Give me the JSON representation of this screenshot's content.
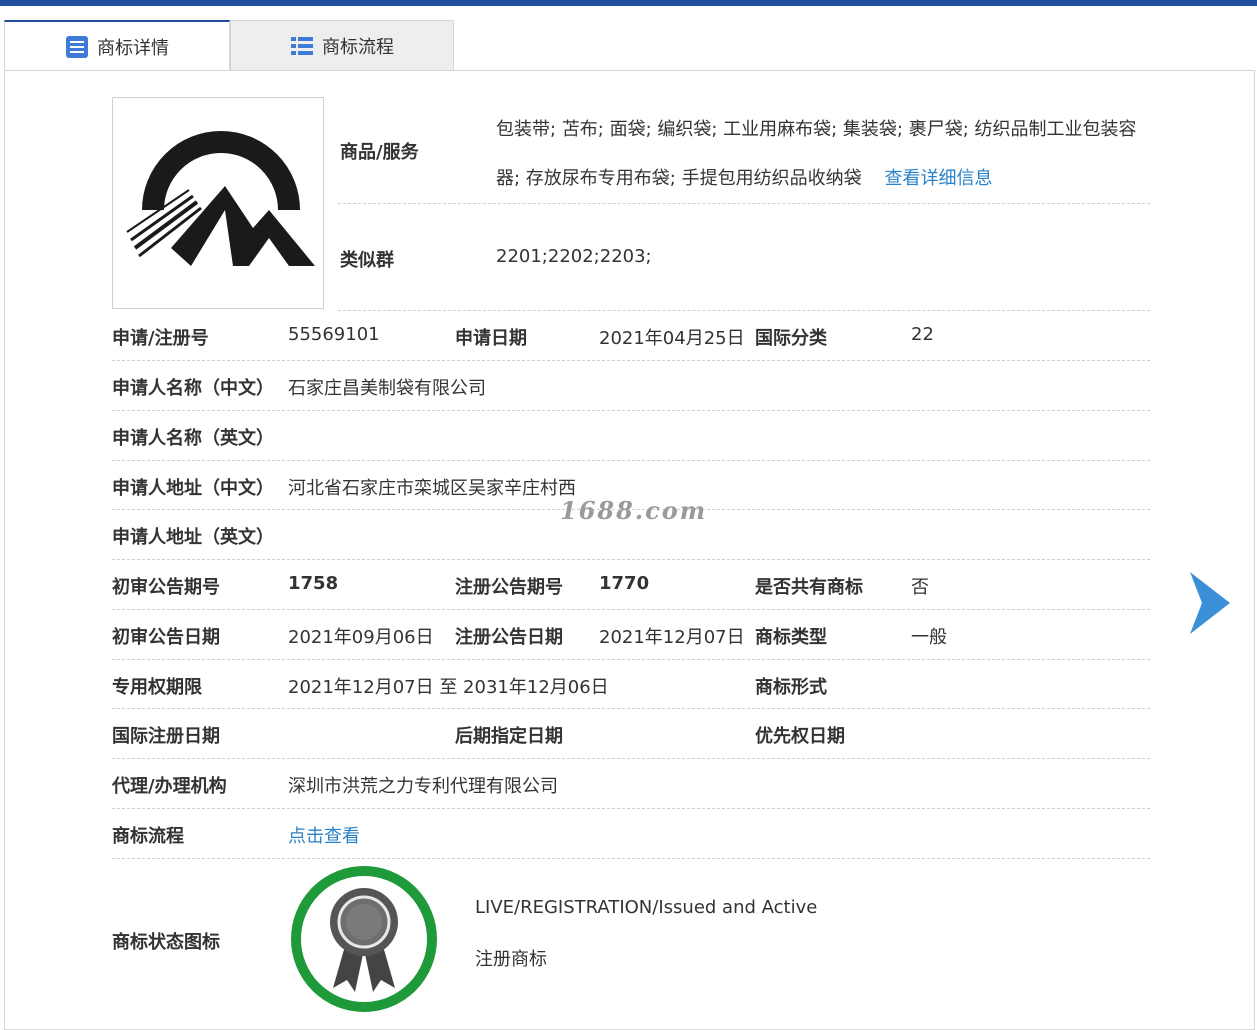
{
  "tabs": {
    "details_label": "商标详情",
    "flow_label": "商标流程"
  },
  "goods": {
    "label": "商品/服务",
    "text": "包装带; 苫布; 面袋; 编织袋; 工业用麻布袋; 集装袋; 裹尸袋; 纺织品制工业包装容器; 存放尿布专用布袋; 手提包用纺织品收纳袋",
    "detail_link": "查看详细信息"
  },
  "similar_group": {
    "label": "类似群",
    "value": "2201;2202;2203;"
  },
  "rows": {
    "reg_no_label": "申请/注册号",
    "reg_no": "55569101",
    "apply_date_label": "申请日期",
    "apply_date": "2021年04月25日",
    "intl_class_label": "国际分类",
    "intl_class": "22",
    "applicant_cn_label": "申请人名称（中文）",
    "applicant_cn": "石家庄昌美制袋有限公司",
    "applicant_en_label": "申请人名称（英文）",
    "address_cn_label": "申请人地址（中文）",
    "address_cn": "河北省石家庄市栾城区吴家辛庄村西",
    "address_en_label": "申请人地址（英文）",
    "prelim_no_label": "初审公告期号",
    "prelim_no": "1758",
    "reg_pub_no_label": "注册公告期号",
    "reg_pub_no": "1770",
    "shared_label": "是否共有商标",
    "shared": "否",
    "prelim_date_label": "初审公告日期",
    "prelim_date": "2021年09月06日",
    "reg_pub_date_label": "注册公告日期",
    "reg_pub_date": "2021年12月07日",
    "tm_type_label": "商标类型",
    "tm_type": "一般",
    "term_label": "专用权期限",
    "term": "2021年12月07日 至 2031年12月06日",
    "tm_form_label": "商标形式",
    "intl_reg_date_label": "国际注册日期",
    "later_date_label": "后期指定日期",
    "priority_date_label": "优先权日期",
    "agency_label": "代理/办理机构",
    "agency": "深圳市洪荒之力专利代理有限公司",
    "flow_label": "商标流程",
    "flow_link": "点击查看",
    "status_icon_label": "商标状态图标",
    "status_en": "LIVE/REGISTRATION/Issued and Active",
    "status_cn": "注册商标"
  },
  "watermark": "1688.com",
  "colors": {
    "tab_accent": "#1f4e9c",
    "link": "#2a82c9",
    "arrow": "#3a8fd6",
    "status_ring": "#1e9a3a"
  },
  "icons": {
    "details_tab": "list-doc-icon",
    "flow_tab": "list-icon",
    "next": "chevron-right-icon",
    "status": "award-ribbon-icon"
  }
}
